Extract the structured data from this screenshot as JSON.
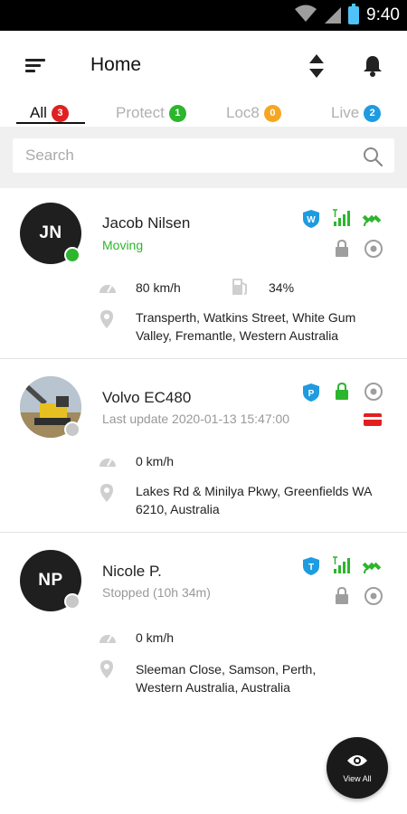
{
  "status_bar": {
    "time": "9:40"
  },
  "header": {
    "title": "Home"
  },
  "tabs": [
    {
      "label": "All",
      "count": "3",
      "color": "#e02020"
    },
    {
      "label": "Protect",
      "count": "1",
      "color": "#2db52d"
    },
    {
      "label": "Loc8",
      "count": "0",
      "color": "#f5a623"
    },
    {
      "label": "Live",
      "count": "2",
      "color": "#1f9be0"
    }
  ],
  "search": {
    "placeholder": "Search"
  },
  "assets": [
    {
      "initials": "JN",
      "name": "Jacob Nilsen",
      "status": "Moving",
      "status_color": "#2fb52f",
      "speed": "80 km/h",
      "fuel": "34%",
      "address": "Transperth, Watkins Street, White Gum Valley, Fremantle, Western Australia",
      "badge_letter": "W",
      "icons": [
        "shield-w-icon",
        "signal-icon",
        "satellite-icon",
        "lock-icon",
        "target-icon"
      ]
    },
    {
      "initials": "",
      "name": "Volvo EC480",
      "status": "Last update 2020-01-13 15:47:00",
      "status_color": "#999999",
      "speed": "0 km/h",
      "address": "Lakes Rd & Minilya Pkwy, Greenfields WA 6210, Australia",
      "badge_letter": "P",
      "icons": [
        "shield-p-icon",
        "lock-icon",
        "target-icon",
        "card-icon"
      ]
    },
    {
      "initials": "NP",
      "name": "Nicole P.",
      "status": "Stopped (10h 34m)",
      "status_color": "#999999",
      "speed": "0 km/h",
      "address": "Sleeman Close, Samson, Perth, Western Australia, Australia",
      "badge_letter": "T",
      "icons": [
        "shield-t-icon",
        "signal-icon",
        "satellite-icon",
        "lock-icon",
        "target-icon"
      ]
    }
  ],
  "fab": {
    "label": "View All"
  },
  "colors": {
    "accent_blue": "#1f9be0",
    "green": "#2db52d",
    "red": "#e02020",
    "gray_icon": "#9e9e9e"
  }
}
